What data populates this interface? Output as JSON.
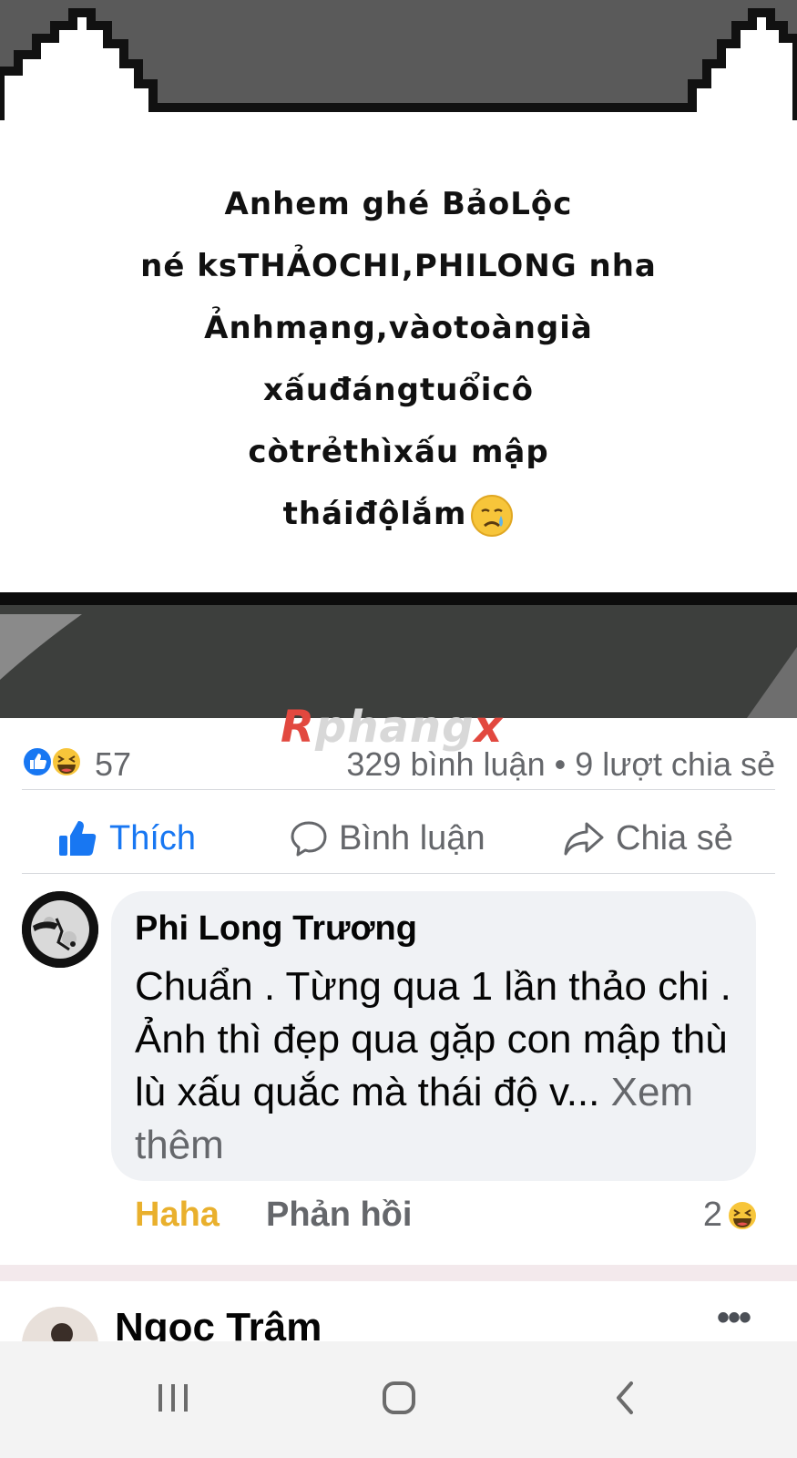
{
  "post_image": {
    "meme_lines": [
      "Anhem ghé BảoLộc",
      "né ksTHẢOCHI,PHILONG nha",
      "Ảnhmạng,vàotoàngià",
      "xấuđángtuổicô",
      "còtrẻthìxấu mập",
      "tháiđộlắm"
    ],
    "emoji_icon": "crying-face-icon"
  },
  "watermark": {
    "part_a": "R",
    "part_b": "phang",
    "part_c": "x"
  },
  "stats": {
    "reaction_icons": [
      "like-reaction-icon",
      "haha-reaction-icon"
    ],
    "reaction_count": "57",
    "comments_shares": "329 bình luận • 9 lượt chia sẻ"
  },
  "actions": {
    "like_label": "Thích",
    "comment_label": "Bình luận",
    "share_label": "Chia sẻ",
    "like_active_color": "#1877f2"
  },
  "comment": {
    "author": "Phi Long Trương",
    "body": "Chuẩn . Từng qua 1 lần thảo chi . Ảnh thì đẹp qua gặp con mập thù lù xấu quắc mà thái độ v... ",
    "see_more": "Xem thêm",
    "reaction_action": "Haha",
    "reply_action": "Phản hồi",
    "reaction_count": "2",
    "haha_color": "#e9b02d"
  },
  "next_comment": {
    "author": "Ngọc Trâm"
  },
  "navbar": {
    "icons": [
      "recent-apps-icon",
      "home-icon",
      "back-icon"
    ]
  }
}
